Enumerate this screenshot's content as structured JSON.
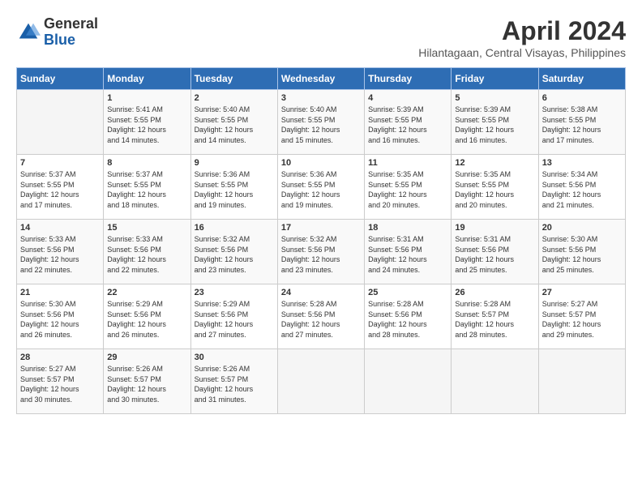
{
  "header": {
    "logo_general": "General",
    "logo_blue": "Blue",
    "month_title": "April 2024",
    "location": "Hilantagaan, Central Visayas, Philippines"
  },
  "calendar": {
    "days_of_week": [
      "Sunday",
      "Monday",
      "Tuesday",
      "Wednesday",
      "Thursday",
      "Friday",
      "Saturday"
    ],
    "weeks": [
      [
        {
          "day": "",
          "info": ""
        },
        {
          "day": "1",
          "info": "Sunrise: 5:41 AM\nSunset: 5:55 PM\nDaylight: 12 hours\nand 14 minutes."
        },
        {
          "day": "2",
          "info": "Sunrise: 5:40 AM\nSunset: 5:55 PM\nDaylight: 12 hours\nand 14 minutes."
        },
        {
          "day": "3",
          "info": "Sunrise: 5:40 AM\nSunset: 5:55 PM\nDaylight: 12 hours\nand 15 minutes."
        },
        {
          "day": "4",
          "info": "Sunrise: 5:39 AM\nSunset: 5:55 PM\nDaylight: 12 hours\nand 16 minutes."
        },
        {
          "day": "5",
          "info": "Sunrise: 5:39 AM\nSunset: 5:55 PM\nDaylight: 12 hours\nand 16 minutes."
        },
        {
          "day": "6",
          "info": "Sunrise: 5:38 AM\nSunset: 5:55 PM\nDaylight: 12 hours\nand 17 minutes."
        }
      ],
      [
        {
          "day": "7",
          "info": "Sunrise: 5:37 AM\nSunset: 5:55 PM\nDaylight: 12 hours\nand 17 minutes."
        },
        {
          "day": "8",
          "info": "Sunrise: 5:37 AM\nSunset: 5:55 PM\nDaylight: 12 hours\nand 18 minutes."
        },
        {
          "day": "9",
          "info": "Sunrise: 5:36 AM\nSunset: 5:55 PM\nDaylight: 12 hours\nand 19 minutes."
        },
        {
          "day": "10",
          "info": "Sunrise: 5:36 AM\nSunset: 5:55 PM\nDaylight: 12 hours\nand 19 minutes."
        },
        {
          "day": "11",
          "info": "Sunrise: 5:35 AM\nSunset: 5:55 PM\nDaylight: 12 hours\nand 20 minutes."
        },
        {
          "day": "12",
          "info": "Sunrise: 5:35 AM\nSunset: 5:55 PM\nDaylight: 12 hours\nand 20 minutes."
        },
        {
          "day": "13",
          "info": "Sunrise: 5:34 AM\nSunset: 5:56 PM\nDaylight: 12 hours\nand 21 minutes."
        }
      ],
      [
        {
          "day": "14",
          "info": "Sunrise: 5:33 AM\nSunset: 5:56 PM\nDaylight: 12 hours\nand 22 minutes."
        },
        {
          "day": "15",
          "info": "Sunrise: 5:33 AM\nSunset: 5:56 PM\nDaylight: 12 hours\nand 22 minutes."
        },
        {
          "day": "16",
          "info": "Sunrise: 5:32 AM\nSunset: 5:56 PM\nDaylight: 12 hours\nand 23 minutes."
        },
        {
          "day": "17",
          "info": "Sunrise: 5:32 AM\nSunset: 5:56 PM\nDaylight: 12 hours\nand 23 minutes."
        },
        {
          "day": "18",
          "info": "Sunrise: 5:31 AM\nSunset: 5:56 PM\nDaylight: 12 hours\nand 24 minutes."
        },
        {
          "day": "19",
          "info": "Sunrise: 5:31 AM\nSunset: 5:56 PM\nDaylight: 12 hours\nand 25 minutes."
        },
        {
          "day": "20",
          "info": "Sunrise: 5:30 AM\nSunset: 5:56 PM\nDaylight: 12 hours\nand 25 minutes."
        }
      ],
      [
        {
          "day": "21",
          "info": "Sunrise: 5:30 AM\nSunset: 5:56 PM\nDaylight: 12 hours\nand 26 minutes."
        },
        {
          "day": "22",
          "info": "Sunrise: 5:29 AM\nSunset: 5:56 PM\nDaylight: 12 hours\nand 26 minutes."
        },
        {
          "day": "23",
          "info": "Sunrise: 5:29 AM\nSunset: 5:56 PM\nDaylight: 12 hours\nand 27 minutes."
        },
        {
          "day": "24",
          "info": "Sunrise: 5:28 AM\nSunset: 5:56 PM\nDaylight: 12 hours\nand 27 minutes."
        },
        {
          "day": "25",
          "info": "Sunrise: 5:28 AM\nSunset: 5:56 PM\nDaylight: 12 hours\nand 28 minutes."
        },
        {
          "day": "26",
          "info": "Sunrise: 5:28 AM\nSunset: 5:57 PM\nDaylight: 12 hours\nand 28 minutes."
        },
        {
          "day": "27",
          "info": "Sunrise: 5:27 AM\nSunset: 5:57 PM\nDaylight: 12 hours\nand 29 minutes."
        }
      ],
      [
        {
          "day": "28",
          "info": "Sunrise: 5:27 AM\nSunset: 5:57 PM\nDaylight: 12 hours\nand 30 minutes."
        },
        {
          "day": "29",
          "info": "Sunrise: 5:26 AM\nSunset: 5:57 PM\nDaylight: 12 hours\nand 30 minutes."
        },
        {
          "day": "30",
          "info": "Sunrise: 5:26 AM\nSunset: 5:57 PM\nDaylight: 12 hours\nand 31 minutes."
        },
        {
          "day": "",
          "info": ""
        },
        {
          "day": "",
          "info": ""
        },
        {
          "day": "",
          "info": ""
        },
        {
          "day": "",
          "info": ""
        }
      ]
    ]
  }
}
